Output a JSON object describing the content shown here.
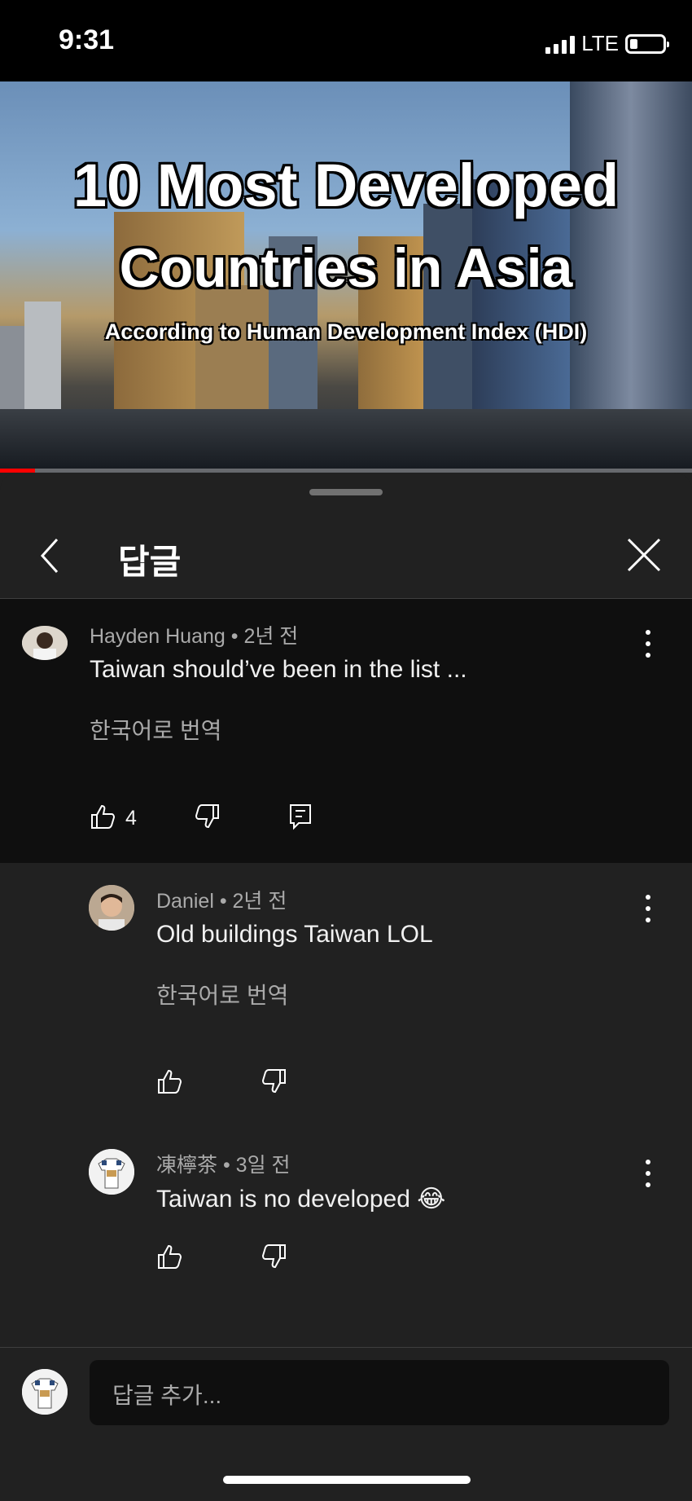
{
  "status_bar": {
    "time": "9:31",
    "network": "LTE"
  },
  "video": {
    "title_line1": "10 Most Developed",
    "title_line2": "Countries in Asia",
    "subtitle": "According to Human Development Index (HDI)",
    "progress_fraction": 0.05
  },
  "sheet": {
    "title": "답글"
  },
  "comments": [
    {
      "author": "Hayden Huang",
      "time": "2년 전",
      "text": "Taiwan should’ve been in the list ...",
      "translate": "한국어로 번역",
      "likes": "4"
    },
    {
      "author": "Daniel",
      "time": "2년 전",
      "text": "Old buildings Taiwan LOL",
      "translate": "한국어로 번역"
    },
    {
      "author": "凍檸茶",
      "time": "3일 전",
      "text": "Taiwan is no developed 😂"
    }
  ],
  "footer": {
    "reply_placeholder": "답글 추가..."
  },
  "colors": {
    "background": "#212121",
    "parent_highlight": "#0f0f0f",
    "progress": "#ff0000"
  }
}
